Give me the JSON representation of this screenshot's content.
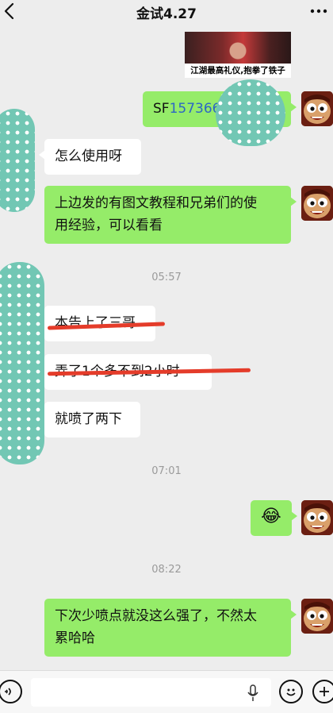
{
  "header": {
    "title": "金试4.27",
    "back_icon": "chevron-left-icon",
    "more_icon": "more-dots-icon"
  },
  "image_card": {
    "caption": "江湖最高礼仪,抱拳了铁子"
  },
  "messages": [
    {
      "side": "me",
      "prefix": "SF",
      "code": "1573660",
      "has_link": true
    },
    {
      "side": "other",
      "text": "怎么使用呀"
    },
    {
      "side": "me",
      "line1": "上边发的有图文教程和兄弟们的使",
      "line2": "用经验，可以看看"
    },
    {
      "side": "other",
      "text": "本告上了三哥"
    },
    {
      "side": "other",
      "text": "弄了1个多不到2小时"
    },
    {
      "side": "other",
      "text": "就喷了两下"
    },
    {
      "side": "me",
      "emoji": "😂",
      "emoji_name": "face-with-tears-of-joy-icon"
    },
    {
      "side": "me",
      "line1": "下次少喷点就没这么强了，不然太",
      "line2": "累哈哈"
    }
  ],
  "timestamps": [
    "05:57",
    "07:01",
    "08:22"
  ],
  "input_bar": {
    "voice_icon": "voice-icon",
    "input_value": "",
    "mic_icon": "mic-icon",
    "emoji_icon": "emoji-icon",
    "plus_icon": "plus-icon"
  },
  "colors": {
    "background": "#ededed",
    "my_bubble": "#95ec69",
    "other_bubble": "#ffffff",
    "link_blue": "#2c66c6",
    "timestamp": "#9a9a9a",
    "privacy_blob": "#72c7b4",
    "strike_red": "#e43c2a"
  }
}
